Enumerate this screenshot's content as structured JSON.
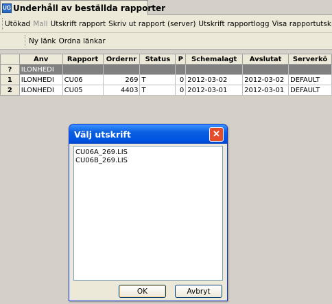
{
  "tab": {
    "icon_text": "UG",
    "title": "Underhåll av beställda rapporter"
  },
  "toolbar1": {
    "items": [
      {
        "label": "Utökad",
        "enabled": true
      },
      {
        "label": "Mall",
        "enabled": false
      },
      {
        "label": "Utskrift rapport",
        "enabled": true
      },
      {
        "label": "Skriv ut rapport (server)",
        "enabled": true
      },
      {
        "label": "Utskrift rapportlogg",
        "enabled": true
      },
      {
        "label": "Visa rapportutskrift",
        "enabled": true
      }
    ]
  },
  "toolbar2": {
    "items": [
      {
        "label": "Ny länk"
      },
      {
        "label": "Ordna länkar"
      }
    ]
  },
  "grid": {
    "columns": [
      "Anv",
      "Rapport",
      "Ordernr",
      "Status",
      "P",
      "Schemalagt",
      "Avslutat",
      "Serverkö"
    ],
    "new_row": {
      "marker": "?",
      "anv": "ILONHEDI"
    },
    "rows": [
      {
        "num": "1",
        "anv": "ILONHEDI",
        "rapport": "CU06",
        "ordernr": "269",
        "status": "T",
        "p": "0",
        "schemalagt": "2012-03-02",
        "avslutat": "2012-03-02",
        "serverko": "DEFAULT"
      },
      {
        "num": "2",
        "anv": "ILONHEDI",
        "rapport": "CU05",
        "ordernr": "4403",
        "status": "T",
        "p": "0",
        "schemalagt": "2012-03-01",
        "avslutat": "2012-03-01",
        "serverko": "DEFAULT"
      }
    ]
  },
  "dialog": {
    "title": "Välj utskrift",
    "close_glyph": "✕",
    "files": [
      "CU06A_269.LIS",
      "CU06B_269.LIS"
    ],
    "ok_label": "OK",
    "cancel_label": "Avbryt"
  },
  "colors": {
    "titlebar": "#0054e3",
    "close": "#e44c2c",
    "background": "#d4d0c8"
  }
}
